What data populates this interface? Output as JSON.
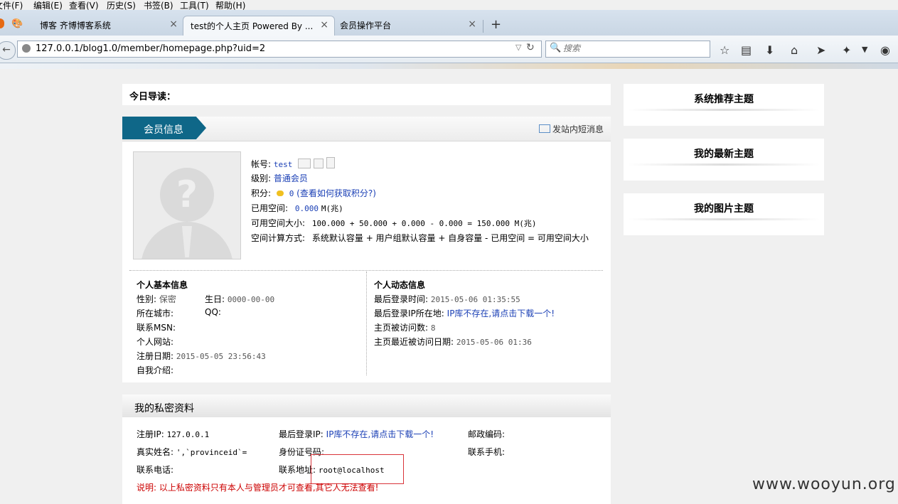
{
  "menu": [
    "文件(F)",
    "编辑(E)",
    "查看(V)",
    "历史(S)",
    "书签(B)",
    "工具(T)",
    "帮助(H)"
  ],
  "tabs": [
    {
      "label": "博客 齐博博客系统",
      "close": "×"
    },
    {
      "label": "test的个人主页 Powered By ...",
      "close": "×"
    },
    {
      "label": "会员操作平台",
      "close": "×"
    }
  ],
  "newtab": "+",
  "address": {
    "url": "127.0.0.1/blog1.0/member/homepage.php?uid=2"
  },
  "search": {
    "placeholder": "搜索"
  },
  "guide": {
    "title": "今日导读："
  },
  "member": {
    "tab": "会员信息",
    "send_msg": "发站内短消息",
    "account_label": "帐号:",
    "account": "test",
    "level_label": "级别:",
    "level": "普通会员",
    "points_label": "积分:",
    "points": "0",
    "points_link": "(查看如何获取积分?)",
    "used_label": "已用空间:",
    "used_value": "0.000",
    "used_unit": "M(兆)",
    "avail_label": "可用空间大小:",
    "avail_value": "100.000 + 50.000 + 0.000 - 0.000 = 150.000 M(兆)",
    "calc_label": "空间计算方式:",
    "calc_value": "系统默认容量 + 用户组默认容量 + 自身容量 - 已用空间 = 可用空间大小"
  },
  "basic": {
    "title": "个人基本信息",
    "gender_label": "性别:",
    "gender": "保密",
    "birthday_label": "生日:",
    "birthday": "0000-00-00",
    "city_label": "所在城市:",
    "qq_label": "QQ:",
    "msn_label": "联系MSN:",
    "site_label": "个人网站:",
    "regdate_label": "注册日期:",
    "regdate": "2015-05-05 23:56:43",
    "intro_label": "自我介绍:"
  },
  "dynamic": {
    "title": "个人动态信息",
    "lastlogin_label": "最后登录时间:",
    "lastlogin": "2015-05-06 01:35:55",
    "lastip_label": "最后登录IP所在地:",
    "lastip": "IP库不存在,请点击下载一个!",
    "visits_label": "主页被访问数:",
    "visits": "8",
    "lastvisit_label": "主页最近被访问日期:",
    "lastvisit": "2015-05-06 01:36"
  },
  "sidebar": [
    "系统推荐主题",
    "我的最新主题",
    "我的图片主题"
  ],
  "private": {
    "title": "我的私密资料",
    "regip_label": "注册IP:",
    "regip": "127.0.0.1",
    "lastip_label": "最后登录IP:",
    "lastip": "IP库不存在,请点击下载一个!",
    "zip_label": "邮政编码:",
    "realname_label": "真实姓名:",
    "realname": "',`provinceid`=",
    "idcard_label": "身份证号码:",
    "mobile_label": "联系手机:",
    "phone_label": "联系电话:",
    "address_label": "联系地址:",
    "address": "root@localhost",
    "note": "说明: 以上私密资料只有本人与管理员才可查看,其它人无法查看!"
  },
  "watermark": "www.wooyun.org",
  "colors": {
    "tab_active": "#0f6788",
    "link": "#1a3fb5",
    "warning": "#cc0000"
  }
}
